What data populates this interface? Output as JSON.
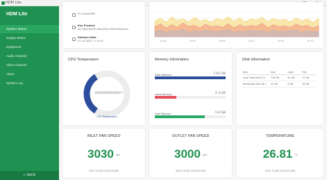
{
  "window": {
    "title": "HDM Lite",
    "controls": [
      "–",
      "□",
      "✕"
    ]
  },
  "sidebar": {
    "brand": "HDM Lite",
    "items": [
      {
        "label": "System Status",
        "active": true
      },
      {
        "label": "Supply Status",
        "active": false
      },
      {
        "label": "Equipment",
        "active": false
      },
      {
        "label": "Audio Channel",
        "active": false
      },
      {
        "label": "Video Channel",
        "active": false
      },
      {
        "label": "Alarm",
        "active": false
      },
      {
        "label": "System Log",
        "active": false
      }
    ],
    "footer": "← BACK"
  },
  "system_info": [
    {
      "icon": "cpu-icon",
      "label": "",
      "value": "IO: Server/PW"
    },
    {
      "icon": "chip-icon",
      "label": "Key Product",
      "value": "All Lite/Intel(R) Xeon(R)/2.00GHz/Ubuntu"
    },
    {
      "icon": "calendar-icon",
      "label": "Release Date",
      "value": "07-14-2021 / 1.0.0.0"
    }
  ],
  "cpu": {
    "title": "CPU Temperature",
    "value_text": "00000000000000°C",
    "legend": "CPU Temperature",
    "gauge_percent": 0.32,
    "color": "#2c4c9c"
  },
  "memory": {
    "title": "Memory Information",
    "rows": [
      {
        "label": "Total Memory",
        "value": "7.92 GB",
        "percent": 1.0,
        "color": "#2c4c9c"
      },
      {
        "label": "Used Memory",
        "value": "2.3 GB",
        "percent": 0.3,
        "color": "#e8505b"
      },
      {
        "label": "Free Memory",
        "value": "5.6 GB",
        "percent": 0.71,
        "color": "#2aa866"
      }
    ]
  },
  "disk": {
    "title": "Disk Information",
    "headers": [
      "Disk",
      "Size",
      "Used",
      "Free"
    ],
    "rows": [
      [
        "Local Fixed Disk (C:)",
        "118 GB",
        "61 GB",
        "57 GB"
      ],
      [
        "Removable Disk (D:)",
        "29 GB",
        "0 GB",
        "29 GB"
      ]
    ]
  },
  "stats": [
    {
      "title": "INLET FAN SPEED",
      "value": "3030",
      "unit": "rpm",
      "time": "2021-10-08 10:20:00.000"
    },
    {
      "title": "OUTLET FAN SPEED",
      "value": "3000",
      "unit": "rpm",
      "time": "2021-10-08 10:20:00.000"
    },
    {
      "title": "TEMPERATURE",
      "value": "26.81",
      "unit": "°C",
      "time": "2021-10-08 10:20:00.000"
    }
  ],
  "chart_data": {
    "type": "area",
    "title": "",
    "xlabel": "",
    "ylabel": "",
    "categories": [
      "10:05",
      "10:07",
      "10:09",
      "10:11",
      "10:13",
      "10:15"
    ],
    "series": [
      {
        "color": "#f4d36b",
        "values": [
          62,
          75,
          58,
          80,
          66,
          72,
          60,
          78,
          64,
          70,
          58,
          74,
          66,
          80,
          62,
          76,
          60,
          72,
          68,
          78,
          62,
          74,
          66,
          70,
          60,
          76,
          64,
          72,
          58,
          74
        ]
      },
      {
        "color": "#f0937c",
        "values": [
          40,
          52,
          35,
          48,
          38,
          55,
          42,
          46,
          36,
          50,
          40,
          44,
          38,
          52,
          36,
          48,
          40,
          46,
          42,
          54,
          36,
          48,
          40,
          44,
          38,
          50,
          42,
          46,
          36,
          44
        ]
      },
      {
        "color": "#b4b8c8",
        "values": [
          20,
          26,
          18,
          24,
          22,
          28,
          18,
          24,
          20,
          26,
          22,
          20,
          24,
          28,
          18,
          22,
          20,
          26,
          22,
          24,
          18,
          26,
          20,
          22,
          24,
          26,
          18,
          24,
          20,
          22
        ]
      }
    ]
  }
}
